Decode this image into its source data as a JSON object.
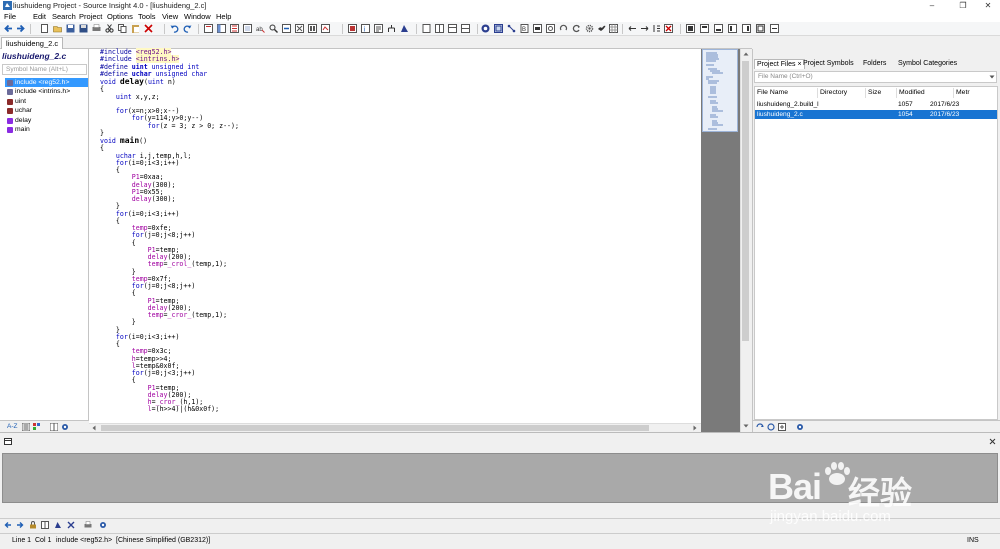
{
  "window": {
    "title": "liushuideng Project - Source Insight 4.0 - [liushuideng_2.c]"
  },
  "menu": [
    "File",
    "Edit",
    "Search",
    "Project",
    "Options",
    "Tools",
    "View",
    "Window",
    "Help"
  ],
  "editor_tab": "liushuideng_2.c",
  "symbol_window": {
    "header": "liushuideng_2.c",
    "search_placeholder": "Symbol Name (Alt+L)",
    "items": [
      {
        "label": "include <reg52.h>",
        "kind": "include",
        "selected": true
      },
      {
        "label": "include <intrins.h>",
        "kind": "include",
        "selected": false
      },
      {
        "label": "uint",
        "kind": "define",
        "selected": false
      },
      {
        "label": "uchar",
        "kind": "define",
        "selected": false
      },
      {
        "label": "delay",
        "kind": "function",
        "selected": false
      },
      {
        "label": "main",
        "kind": "function",
        "selected": false
      }
    ],
    "footer_az": "A-Z"
  },
  "code_lines": [
    "#include <reg52.h>",
    "#include <intrins.h>",
    "#define uint unsigned int",
    "#define uchar unsigned char",
    "void delay(uint n)",
    "{",
    "    uint x,y,z;",
    "",
    "    for(x=n;x>0;x--)",
    "        for(y=114;y>0;y--)",
    "            for(z = 3; z > 0; z--);",
    "}",
    "void main()",
    "{",
    "    uchar i,j,temp,h,l;",
    "    for(i=0;i<3;i++)",
    "    {",
    "        P1=0xaa;",
    "        delay(300);",
    "        P1=0x55;",
    "        delay(300);",
    "    }",
    "    for(i=0;i<3;i++)",
    "    {",
    "        temp=0xfe;",
    "        for(j=0;j<8;j++)",
    "        {",
    "            P1=temp;",
    "            delay(200);",
    "            temp=_crol_(temp,1);",
    "        }",
    "        temp=0x7f;",
    "        for(j=0;j<8;j++)",
    "        {",
    "            P1=temp;",
    "            delay(200);",
    "            temp=_cror_(temp,1);",
    "        }",
    "    }",
    "    for(i=0;i<3;i++)",
    "    {",
    "        temp=0x3c;",
    "        h=temp>>4;",
    "        l=temp&0x0f;",
    "        for(j=0;j<3;j++)",
    "        {",
    "            P1=temp;",
    "            delay(200);",
    "            h=_cror_(h,1);",
    "            l=(h>>4)|(h&0x0f);"
  ],
  "project_panel": {
    "tabs": [
      "Project Files",
      "Project Symbols",
      "Folders",
      "Symbol Categories"
    ],
    "close_glyph": "×",
    "search_placeholder": "File Name (Ctrl+O)",
    "columns": [
      "File Name",
      "Directory",
      "Size",
      "Modified",
      "Metr"
    ],
    "files": [
      {
        "name": "liushuideng_2.build_l",
        "directory": "",
        "size": "1057",
        "modified": "2017/6/23",
        "selected": false
      },
      {
        "name": "liushuideng_2.c",
        "directory": "",
        "size": "1054",
        "modified": "2017/6/23",
        "selected": true
      }
    ]
  },
  "status": {
    "line": "Line 1",
    "col": "Col 1",
    "context": "include <reg52.h>",
    "encoding": "[Chinese Simplified (GB2312)]",
    "mode": "INS"
  },
  "watermark": {
    "brand": "Bai",
    "brand_cn": "经验",
    "url": "jingyan.baidu.com"
  },
  "colors": {
    "selection": "#3399ff",
    "keyword": "#0000c0",
    "overview_bg": "#7a7a7a",
    "context_bg": "#a9a9a9"
  }
}
